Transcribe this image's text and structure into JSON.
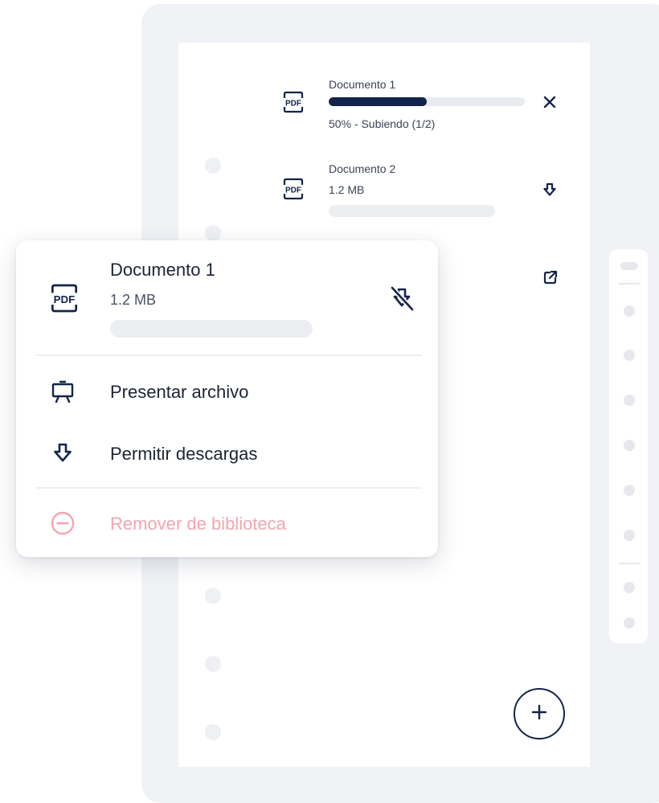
{
  "upload_list": {
    "items": [
      {
        "name": "Documento 1",
        "status": "50% - Subiendo (1/2)",
        "progress": 0.5,
        "file_type": "pdf-icon",
        "action_icon": "close-icon"
      },
      {
        "name": "Documento 2",
        "size": "1.2 MB",
        "file_type": "pdf-icon",
        "action_icon": "download-arrow-icon"
      }
    ],
    "extra_action_icon": "external-link-icon"
  },
  "context_menu": {
    "file": {
      "name": "Documento 1",
      "size": "1.2 MB",
      "file_type": "pdf-icon",
      "status_icon": "download-disabled-icon"
    },
    "items": [
      {
        "label": "Presentar archivo",
        "icon": "presentation-easel-icon"
      },
      {
        "label": "Permitir descargas",
        "icon": "download-arrow-icon"
      },
      {
        "label": "Remover de biblioteca",
        "icon": "minus-circle-icon",
        "danger": true
      }
    ]
  },
  "add_button": {
    "icon": "plus-icon"
  },
  "colors": {
    "accent": "#13244a",
    "danger": "#f2a5ae",
    "panel_bg": "#f0f2f6",
    "skeleton": "#eceef2"
  }
}
